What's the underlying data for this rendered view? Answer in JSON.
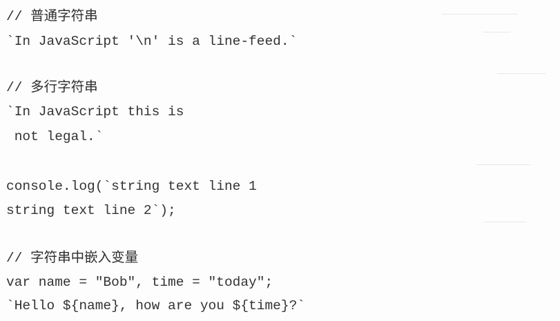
{
  "code": {
    "lines": [
      "// 普通字符串",
      "`In JavaScript '\\n' is a line-feed.`",
      "// 多行字符串",
      "`In JavaScript this is",
      " not legal.`",
      "console.log(`string text line 1",
      "string text line 2`);",
      "// 字符串中嵌入变量",
      "var name = \"Bob\", time = \"today\";",
      "`Hello ${name}, how are you ${time}?`"
    ]
  }
}
